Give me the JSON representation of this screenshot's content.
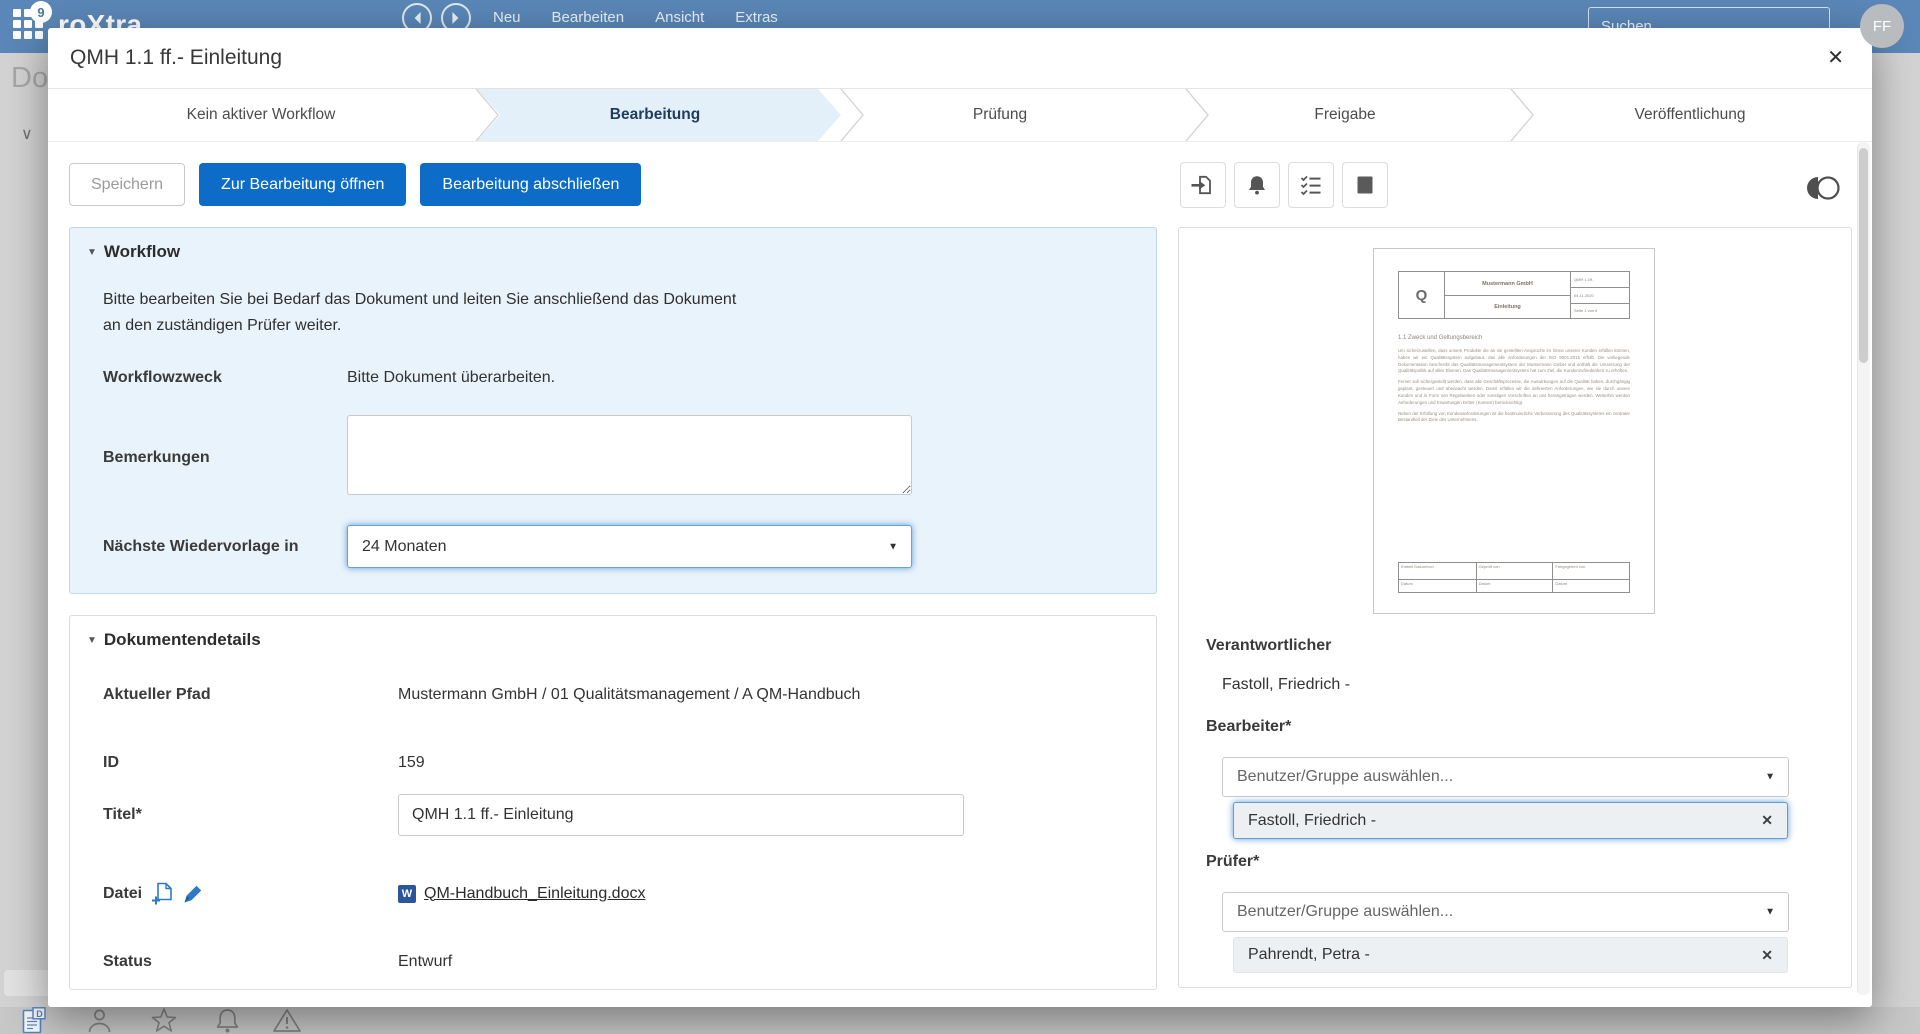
{
  "colors": {
    "header_bg": "#5a87b7",
    "accent": "#0c6cc8",
    "active_step_bg": "#e3f0fa",
    "workflow_card_bg": "#e9f3fb",
    "word_icon_blue": "#2b579a"
  },
  "header": {
    "logo_text": "roXtra",
    "badge": "9",
    "nav": [
      "Neu",
      "Bearbeiten",
      "Ansicht",
      "Extras"
    ],
    "search_text": "Suchen",
    "avatar": "FF"
  },
  "background": {
    "sidebar_heading": "Do",
    "chevron": "∨"
  },
  "modal": {
    "title": "QMH 1.1 ff.- Einleitung",
    "close": "✕",
    "steps": [
      "Kein aktiver Workflow",
      "Bearbeitung",
      "Prüfung",
      "Freigabe",
      "Veröffentlichung"
    ],
    "buttons": {
      "save": "Speichern",
      "open": "Zur Bearbeitung öffnen",
      "finish": "Bearbeitung abschließen"
    },
    "workflow_card": {
      "title": "Workflow",
      "intro_line1": "Bitte bearbeiten Sie bei Bedarf das Dokument und leiten Sie anschließend das Dokument",
      "intro_line2": "an den zuständigen Prüfer weiter.",
      "zweck_label": "Workflowzweck",
      "zweck_value": "Bitte Dokument überarbeiten.",
      "bemerkungen_label": "Bemerkungen",
      "wiedervorlage_label": "Nächste Wiedervorlage in",
      "wiedervorlage_value": "24 Monaten"
    },
    "details_card": {
      "title": "Dokumentendetails",
      "pfad_label": "Aktueller Pfad",
      "pfad_value": "Mustermann GmbH / 01 Qualitätsmanagement / A QM-Handbuch",
      "id_label": "ID",
      "id_value": "159",
      "titel_label": "Titel*",
      "titel_value": "QMH 1.1 ff.- Einleitung",
      "datei_label": "Datei",
      "datei_file": "QM-Handbuch_Einleitung.docx",
      "word_badge": "W",
      "status_label": "Status",
      "status_value": "Entwurf"
    },
    "right_panel": {
      "verantwortlicher_label": "Verantwortlicher",
      "verantwortlicher_value": "Fastoll, Friedrich -",
      "bearbeiter_label": "Bearbeiter*",
      "bearbeiter_placeholder": "Benutzer/Gruppe auswählen...",
      "bearbeiter_chip": "Fastoll, Friedrich -",
      "pruefer_label": "Prüfer*",
      "pruefer_placeholder": "Benutzer/Gruppe auswählen...",
      "pruefer_chip": "Pahrendt, Petra -",
      "chip_remove": "✕",
      "preview": {
        "logo": "Q",
        "company": "Mustermann GmbH",
        "doc_title": "Einleitung",
        "doc_no": "QMH 1.1ff.",
        "date": "04.11.2020",
        "page": "Seite 1 von 6",
        "heading": "1.1  Zweck und Geltungsbereich",
        "para1": "Um sicherzustellen, dass unsere Produkte die an sie gestellten Ansprüche im Sinne unserer Kunden erfüllen können, haben wir ein Qualitätssystem aufgebaut, das alle Anforderungen der ISO 9001:2015 erfüllt. Die vorliegende Dokumentation beschreibt das Qualitätsmanagementsystem der Mustermann GmbH und enthält die Umsetzung der Qualitätspolitik auf allen Ebenen. Das Qualitätsmanagementsystem hat zum Ziel, die Kundenzufriedenheit zu erhöhen.",
        "para2": "Ferner soll sichergestellt werden, dass alle Geschäftsprozesse, die Auswirkungen auf die Qualität haben, durchgängig geplant, gesteuert und überwacht werden. Damit erfüllen wir die definierten Anforderungen, wie sie durch unsere Kunden und in Form von Regelwerken oder sonstigen Vorschriften an uns herangetragen werden. Weiterhin werden Anforderungen und Erwartungen Dritter (Kontext) berücksichtigt.",
        "para3": "Neben der Erfüllung von Kundenanforderungen ist die kontinuierliche Verbesserung des Qualitätssystems ein zentraler Bestandteil der Ziele des Unternehmens.",
        "footer_r1": [
          "Erstellt Datum/von",
          "Geprüft von",
          "Freigegeben von"
        ],
        "footer_r2": [
          "Datum",
          "Datum",
          "Datum"
        ]
      }
    }
  }
}
